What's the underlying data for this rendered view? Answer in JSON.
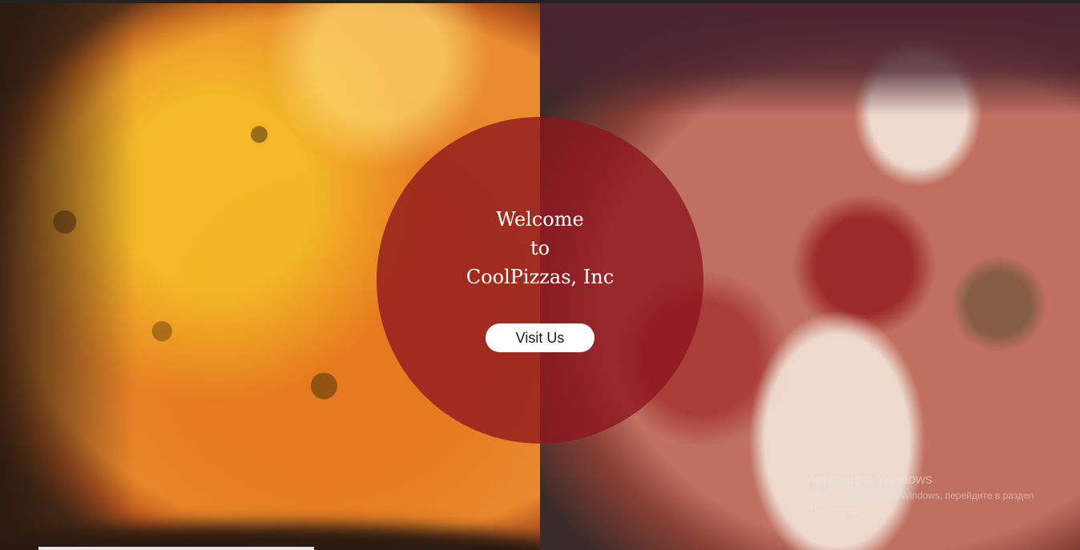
{
  "hero": {
    "welcome_line1": "Welcome",
    "welcome_line2": "to",
    "welcome_line3": "CoolPizzas, Inc",
    "visit_button": "Visit Us",
    "left_image": "pizza-cheese-image",
    "right_image": "pizza-pepperoni-mushroom-image"
  },
  "overlay": {
    "windows_activation_title": "Активация Windows",
    "windows_activation_text": "Чтобы активировать Windows, перейдите в раздел \"Параметры\"."
  },
  "colors": {
    "circle_overlay": "#8c141e",
    "button_bg": "#ffffff"
  }
}
